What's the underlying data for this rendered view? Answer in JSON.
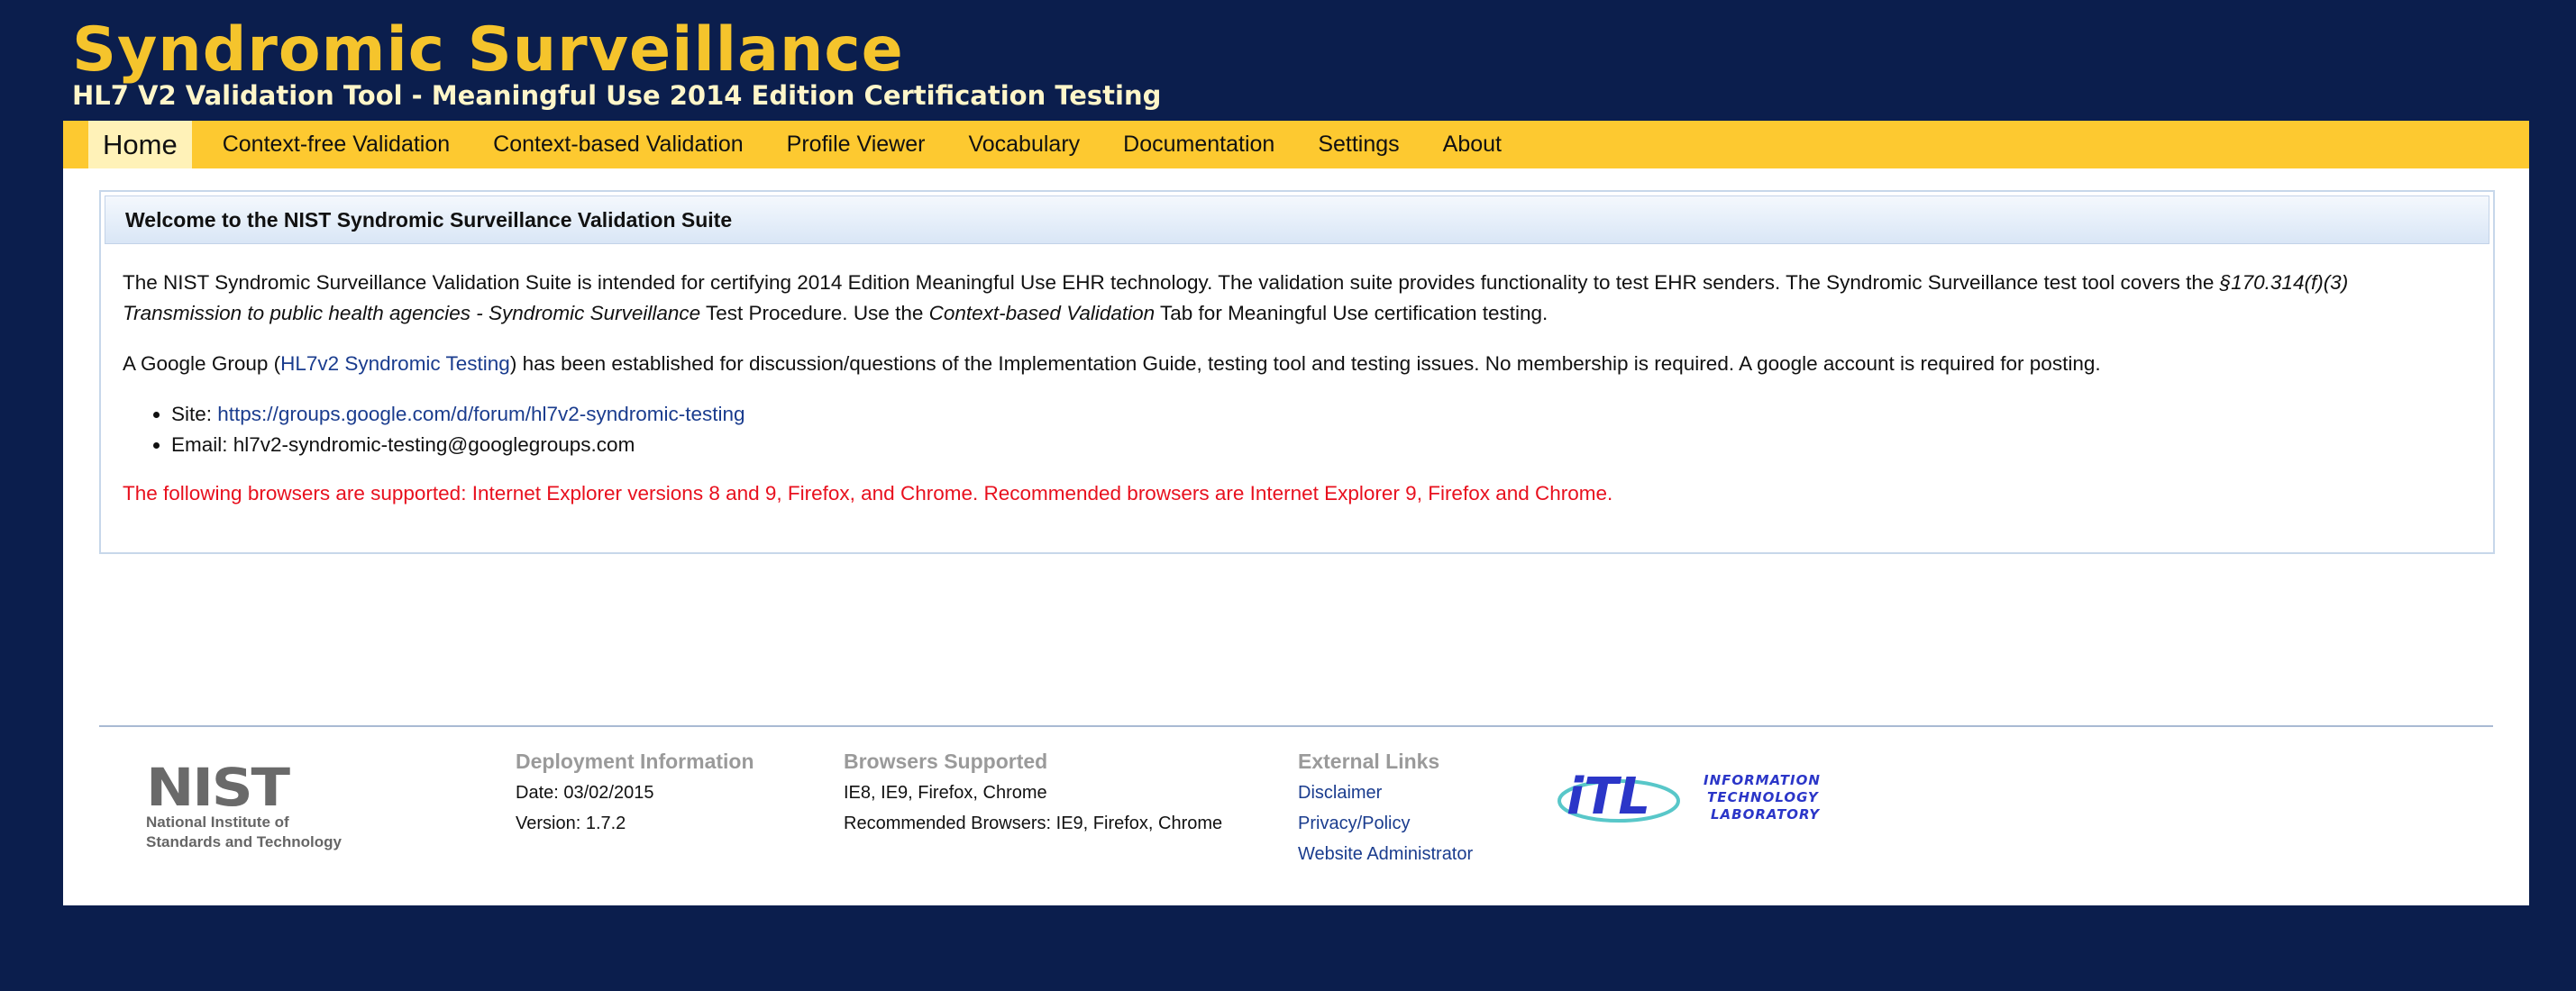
{
  "header": {
    "title": "Syndromic Surveillance",
    "subtitle": "HL7 V2 Validation Tool - Meaningful Use 2014 Edition Certification Testing"
  },
  "nav": {
    "tabs": [
      "Home",
      "Context-free Validation",
      "Context-based Validation",
      "Profile Viewer",
      "Vocabulary",
      "Documentation",
      "Settings",
      "About"
    ],
    "active": "Home"
  },
  "welcome": {
    "heading": "Welcome to the NIST Syndromic Surveillance Validation Suite",
    "p1_a": "The NIST Syndromic Surveillance Validation Suite is intended for certifying 2014 Edition Meaningful Use EHR technology. The validation suite provides functionality to test EHR senders. The Syndromic Surveillance test tool covers the ",
    "p1_b": "§170.314(f)(3) Transmission to public health agencies - Syndromic Surveillance",
    "p1_c": " Test Procedure. Use the ",
    "p1_d": "Context-based Validation",
    "p1_e": " Tab for Meaningful Use certification testing.",
    "p2_a": "A Google Group (",
    "p2_link": "HL7v2 Syndromic Testing",
    "p2_b": ") has been established for discussion/questions of the Implementation Guide, testing tool and testing issues. No membership is required. A google account is required for posting.",
    "site_label": "Site: ",
    "site_url": "https://groups.google.com/d/forum/hl7v2-syndromic-testing",
    "email_label": "Email: ",
    "email": "hl7v2-syndromic-testing@googlegroups.com",
    "browser_notice": "The following browsers are supported: Internet Explorer versions 8 and 9, Firefox, and Chrome. Recommended browsers are Internet Explorer 9, Firefox and Chrome."
  },
  "footer": {
    "nist_mark": "NIST",
    "nist_name_1": "National Institute of",
    "nist_name_2": "Standards and Technology",
    "deployment": {
      "heading": "Deployment Information",
      "date": "Date: 03/02/2015",
      "version": "Version: 1.7.2"
    },
    "browsers": {
      "heading": "Browsers Supported",
      "line1": "IE8, IE9, Firefox, Chrome",
      "line2": "Recommended Browsers: IE9, Firefox, Chrome"
    },
    "links": {
      "heading": "External Links",
      "items": [
        "Disclaimer",
        "Privacy/Policy",
        "Website Administrator"
      ]
    },
    "itl_logo": {
      "mark": "iTL",
      "line1": "INFORMATION",
      "line2": "TECHNOLOGY",
      "line3": "LABORATORY"
    }
  },
  "colors": {
    "background": "#0b1e4d",
    "title_gold": "#f5c42c",
    "nav_bar": "#fdc930",
    "link_blue": "#1a3c8e",
    "warning_red": "#e8101e"
  }
}
